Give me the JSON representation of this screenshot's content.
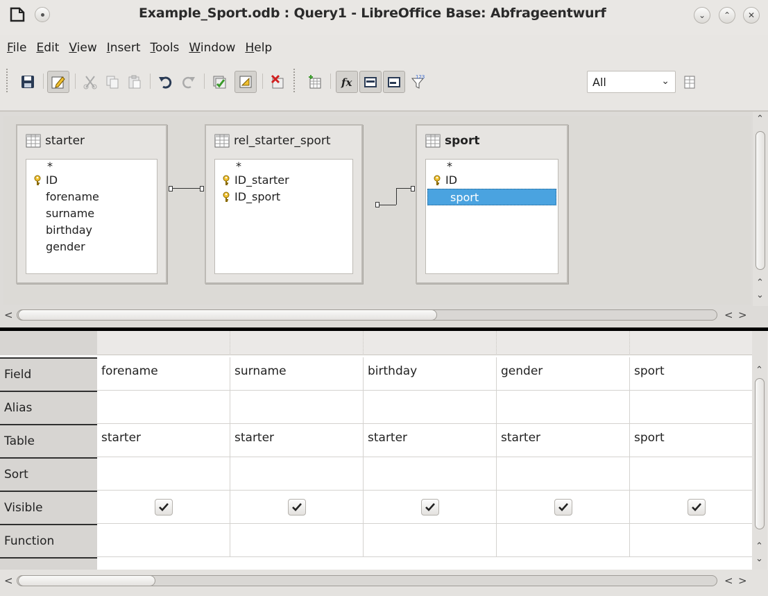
{
  "window": {
    "title": "Example_Sport.odb : Query1 - LibreOffice Base: Abfrageentwurf"
  },
  "menu": {
    "items": [
      {
        "label": "File"
      },
      {
        "label": "Edit"
      },
      {
        "label": "View"
      },
      {
        "label": "Insert"
      },
      {
        "label": "Tools"
      },
      {
        "label": "Window"
      },
      {
        "label": "Help"
      }
    ]
  },
  "toolbar": {
    "buttons": [
      {
        "name": "save-icon"
      },
      {
        "name": "edit-mode-icon",
        "active": true
      },
      {
        "name": "cut-icon"
      },
      {
        "name": "copy-icon"
      },
      {
        "name": "paste-icon"
      },
      {
        "name": "undo-icon"
      },
      {
        "name": "redo-icon"
      },
      {
        "name": "run-query-icon"
      },
      {
        "name": "design-view-toggle-icon",
        "active": true
      },
      {
        "name": "clear-query-icon"
      },
      {
        "name": "switch-design-icon"
      },
      {
        "name": "add-table-icon"
      },
      {
        "name": "functions-icon",
        "active": true
      },
      {
        "name": "table-name-icon",
        "active": true
      },
      {
        "name": "alias-icon",
        "active": true
      },
      {
        "name": "distinct-values-icon"
      },
      {
        "name": "limit-icon"
      }
    ],
    "limit_select": {
      "value": "All"
    }
  },
  "tables": [
    {
      "name": "starter",
      "bold": false,
      "fields": [
        {
          "label": "*",
          "key": false,
          "star": true
        },
        {
          "label": "ID",
          "key": true
        },
        {
          "label": "forename",
          "key": false
        },
        {
          "label": "surname",
          "key": false
        },
        {
          "label": "birthday",
          "key": false
        },
        {
          "label": "gender",
          "key": false
        }
      ]
    },
    {
      "name": "rel_starter_sport",
      "bold": false,
      "fields": [
        {
          "label": "*",
          "key": false,
          "star": true
        },
        {
          "label": "ID_starter",
          "key": true
        },
        {
          "label": "ID_sport",
          "key": true
        }
      ]
    },
    {
      "name": "sport",
      "bold": true,
      "fields": [
        {
          "label": "*",
          "key": false,
          "star": true
        },
        {
          "label": "ID",
          "key": true
        },
        {
          "label": "sport",
          "key": false,
          "selected": true
        }
      ]
    }
  ],
  "grid": {
    "row_labels": [
      "Field",
      "Alias",
      "Table",
      "Sort",
      "Visible",
      "Function"
    ],
    "columns": [
      {
        "field": "forename",
        "alias": "",
        "table": "starter",
        "sort": "",
        "visible": true,
        "function": ""
      },
      {
        "field": "surname",
        "alias": "",
        "table": "starter",
        "sort": "",
        "visible": true,
        "function": ""
      },
      {
        "field": "birthday",
        "alias": "",
        "table": "starter",
        "sort": "",
        "visible": true,
        "function": ""
      },
      {
        "field": "gender",
        "alias": "",
        "table": "starter",
        "sort": "",
        "visible": true,
        "function": ""
      },
      {
        "field": "sport",
        "alias": "",
        "table": "sport",
        "sort": "",
        "visible": true,
        "function": ""
      }
    ]
  },
  "colors": {
    "selection": "#4aa3e0",
    "key_icon": "#d4a017"
  }
}
